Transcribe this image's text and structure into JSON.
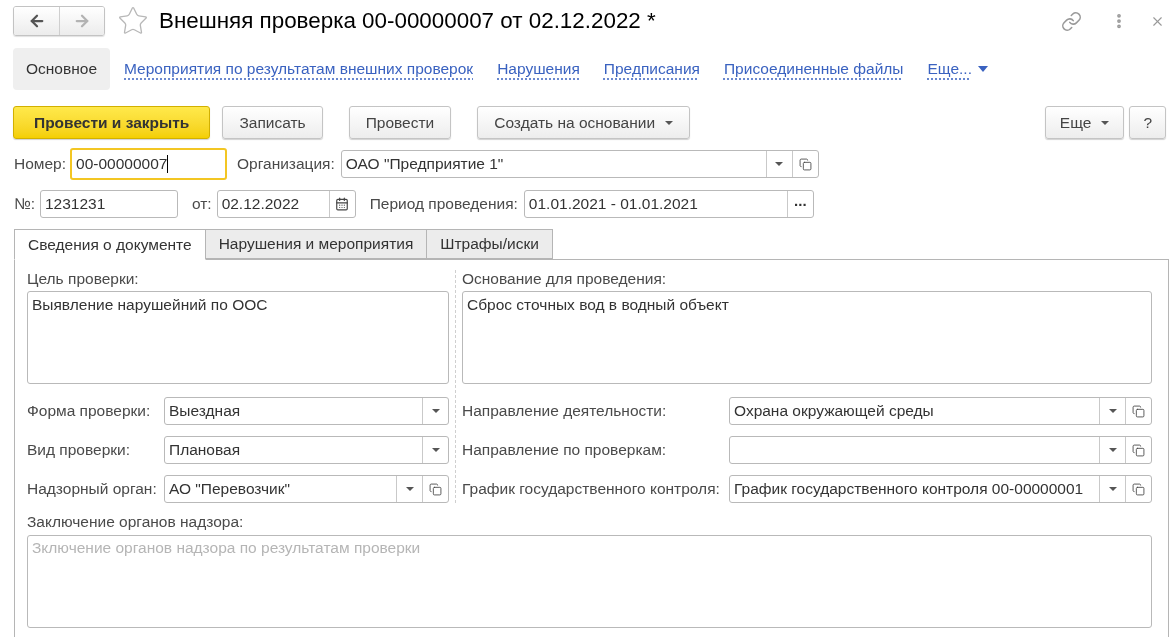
{
  "window": {
    "title": "Внешняя проверка 00-00000007 от 02.12.2022 *",
    "favorite": false,
    "history_buttons": [
      {
        "kind": "back",
        "disabled": false
      },
      {
        "kind": "forward",
        "disabled": true
      }
    ]
  },
  "nav": {
    "items": [
      {
        "label": "Основное",
        "selected": true
      },
      {
        "label": "Мероприятия по результатам внешних проверок",
        "selected": false
      },
      {
        "label": "Нарушения",
        "selected": false
      },
      {
        "label": "Предписания",
        "selected": false
      },
      {
        "label": "Присоединенные файлы",
        "selected": false
      }
    ],
    "more": "Еще..."
  },
  "toolbar": {
    "left": [
      {
        "label": "Провести и закрыть",
        "kind": "primary"
      },
      {
        "label": "Записать",
        "kind": "plain"
      },
      {
        "label": "Провести",
        "kind": "plain"
      },
      {
        "label": "Создать на основании",
        "kind": "menu"
      }
    ],
    "right": [
      {
        "label": "Еще",
        "kind": "menu"
      },
      {
        "label": "?",
        "kind": "plain"
      }
    ]
  },
  "header": {
    "number": {
      "label": "Номер:",
      "value": "00-00000007",
      "focused": true
    },
    "organization": {
      "label": "Организация:",
      "value": "ОАО \"Предприятие 1\"",
      "buttons": [
        {
          "kind": "dropdown"
        },
        {
          "kind": "open"
        }
      ]
    },
    "incoming_number": {
      "label": "№:",
      "value": "1231231"
    },
    "date": {
      "label": "от:",
      "value": "02.12.2022",
      "buttons": [
        {
          "kind": "calendar"
        }
      ]
    },
    "period": {
      "label": "Период проведения:",
      "value": "01.01.2021 - 01.01.2021",
      "buttons": [
        {
          "kind": "choose",
          "label": "..."
        }
      ]
    }
  },
  "tabs": [
    {
      "label": "Сведения о документе",
      "selected": true
    },
    {
      "label": "Нарушения и мероприятия",
      "selected": false
    },
    {
      "label": "Штрафы/иски",
      "selected": false
    }
  ],
  "document_info": {
    "goal": {
      "label": "Цель проверки:",
      "value": "Выявление нарушейний по ООС"
    },
    "basis": {
      "label": "Основание для проведения:",
      "value": "Сброс сточных вод в водный объект"
    },
    "left_fields": [
      {
        "label": "Форма проверки:",
        "value": "Выездная",
        "buttons": [
          {
            "kind": "dropdown"
          }
        ]
      },
      {
        "label": "Вид проверки:",
        "value": "Плановая",
        "buttons": [
          {
            "kind": "dropdown"
          }
        ]
      },
      {
        "label": "Надзорный орган:",
        "value": "АО \"Перевозчик\"",
        "buttons": [
          {
            "kind": "dropdown"
          },
          {
            "kind": "open"
          }
        ]
      }
    ],
    "right_fields": [
      {
        "label": "Направление деятельности:",
        "value": "Охрана окружающей среды",
        "buttons": [
          {
            "kind": "dropdown"
          },
          {
            "kind": "open"
          }
        ]
      },
      {
        "label": "Направление по проверкам:",
        "buttons": [
          {
            "kind": "dropdown"
          },
          {
            "kind": "open"
          }
        ]
      },
      {
        "label": "График государственного контроля:",
        "value": "График государственного контроля 00-00000001",
        "buttons": [
          {
            "kind": "dropdown"
          },
          {
            "kind": "open"
          }
        ]
      }
    ],
    "conclusion": {
      "label": "Заключение органов надзора:",
      "placeholder": "Зключение органов надзора по результатам проверки"
    }
  }
}
